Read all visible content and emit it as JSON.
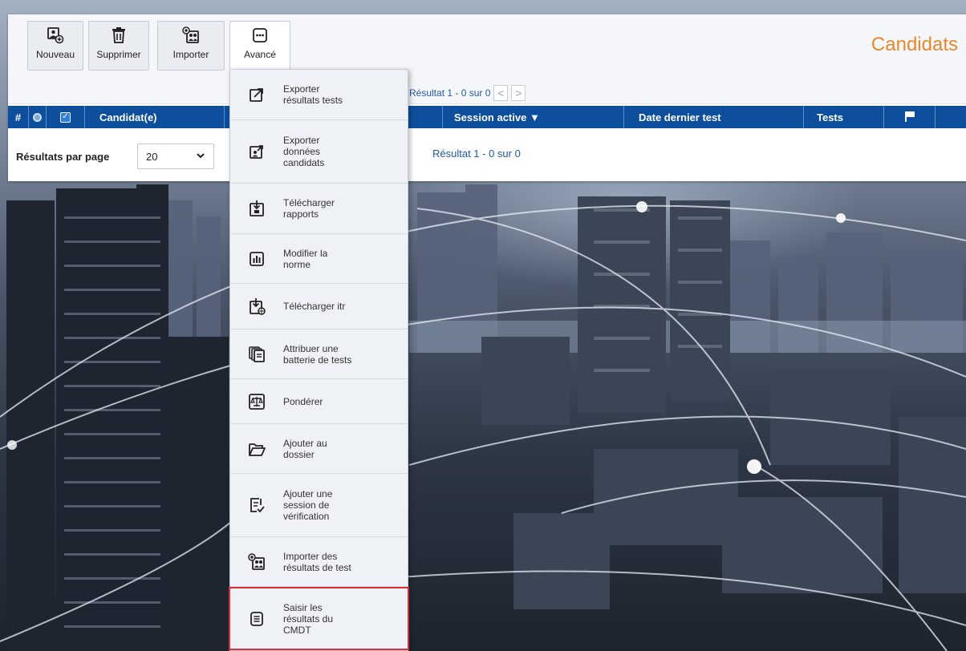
{
  "page_title": "Candidats",
  "toolbar": {
    "new_label": "Nouveau",
    "delete_label": "Supprimer",
    "import_label": "Importer",
    "advanced_label": "Avancé"
  },
  "pager_top": {
    "result_text": "Résultat 1 - 0 sur 0",
    "prev": "<",
    "next": ">"
  },
  "table": {
    "columns": {
      "hash": "#",
      "candidate": "Candidat(e)",
      "active_session": "Session active ▼",
      "last_test_date": "Date dernier test",
      "tests": "Tests"
    }
  },
  "results_per_page": {
    "label": "Résultats par page",
    "value": "20",
    "result_text": "Résultat 1 - 0 sur 0"
  },
  "menu": {
    "items": [
      {
        "label": "Exporter\nrésultats tests",
        "icon": "export-results-icon"
      },
      {
        "label": "Exporter\ndonnées\ncandidats",
        "icon": "export-candidate-data-icon"
      },
      {
        "label": "Télécharger\nrapports",
        "icon": "download-reports-icon"
      },
      {
        "label": "Modifier la\nnorme",
        "icon": "chart-bars-icon"
      },
      {
        "label": "Télécharger itr",
        "icon": "download-itr-icon"
      },
      {
        "label": "Attribuer une\nbatterie de tests",
        "icon": "stack-copy-icon"
      },
      {
        "label": "Pondérer",
        "icon": "balance-scale-icon"
      },
      {
        "label": "Ajouter au\ndossier",
        "icon": "folder-open-icon"
      },
      {
        "label": "Ajouter une\nsession de\nvérification",
        "icon": "checklist-icon"
      },
      {
        "label": "Importer des\nrésultats de test",
        "icon": "import-people-icon"
      },
      {
        "label": "Saisir les\nrésultats du\nCMDT",
        "icon": "document-list-icon"
      }
    ],
    "highlighted_index": 10
  },
  "colors": {
    "header_blue": "#0d4f9c",
    "title_orange": "#e5892b",
    "link_blue": "#1f5aa6",
    "highlight_red": "#d8303a"
  }
}
